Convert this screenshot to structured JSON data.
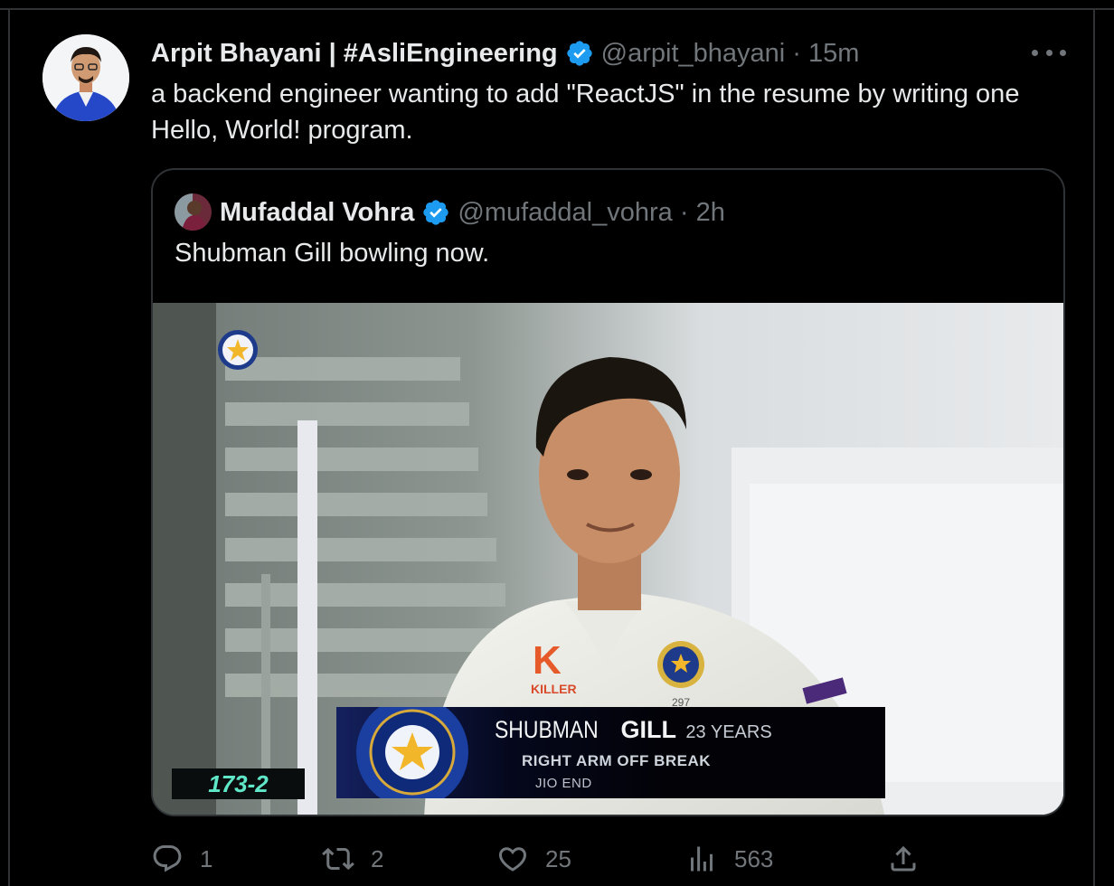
{
  "tweet": {
    "display_name": "Arpit Bhayani | #AsliEngineering",
    "handle": "@arpit_bhayani",
    "separator": "·",
    "time": "15m",
    "text": "a backend engineer wanting to add \"ReactJS\" in the resume by writing one Hello, World! program.",
    "avatar_icon": "profile-photo",
    "more_icon": "more-dots-icon"
  },
  "quoted": {
    "display_name": "Mufaddal Vohra",
    "handle": "@mufaddal_vohra",
    "separator": "·",
    "time": "2h",
    "text": "Shubman Gill bowling now.",
    "media": {
      "score": "173-2",
      "player_first": "SHUBMAN",
      "player_last": "GILL",
      "player_age": "23 YEARS",
      "bowling_style": "RIGHT ARM OFF BREAK",
      "bowling_end": "JIO END",
      "shirt_brand": "KILLER",
      "shirt_number": "297"
    }
  },
  "actions": {
    "replies": "1",
    "retweets": "2",
    "likes": "25",
    "views": "563"
  },
  "colors": {
    "background": "#000000",
    "text_primary": "#e7e9ea",
    "text_secondary": "#71767b",
    "border": "#2f3336",
    "verified_blue": "#1d9bf0",
    "score_text": "#5fe7c8"
  }
}
